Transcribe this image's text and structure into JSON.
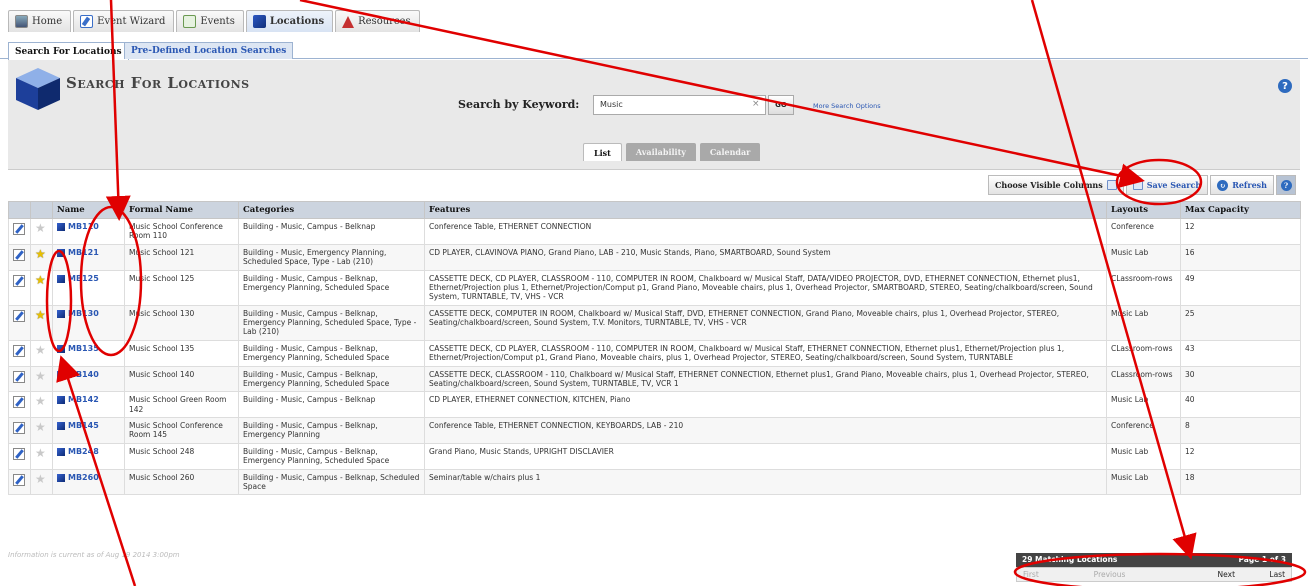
{
  "topnav": {
    "tabs": [
      {
        "label": "Home",
        "icon": "home-icon"
      },
      {
        "label": "Event Wizard",
        "icon": "wizard-icon"
      },
      {
        "label": "Events",
        "icon": "events-icon"
      },
      {
        "label": "Locations",
        "icon": "locations-icon"
      },
      {
        "label": "Resources",
        "icon": "resources-icon"
      }
    ],
    "active": "Locations"
  },
  "subnav": {
    "tabs": [
      "Search For Locations",
      "Pre-Defined Location Searches"
    ]
  },
  "panel": {
    "title": "Search For Locations",
    "help": "?",
    "keyword_label": "Search by Keyword:",
    "keyword_value": "Music",
    "clear": "×",
    "go": "GO",
    "more": "More Search Options",
    "views": [
      "List",
      "Availability",
      "Calendar"
    ]
  },
  "toolbar": {
    "choose": "Choose Visible Columns",
    "save": "Save Search",
    "refresh": "Refresh",
    "help": "?"
  },
  "table": {
    "headers": [
      "",
      "",
      "Name",
      "Formal Name",
      "Categories",
      "Features",
      "Layouts",
      "Max Capacity"
    ],
    "rows": [
      {
        "fav": false,
        "name": "MB110",
        "formal": "Music School Conference Room 110",
        "cat": "Building - Music, Campus - Belknap",
        "feat": "Conference Table, ETHERNET CONNECTION",
        "layout": "Conference",
        "cap": "12"
      },
      {
        "fav": true,
        "name": "MB121",
        "formal": "Music School 121",
        "cat": "Building - Music, Emergency Planning, Scheduled Space, Type - Lab (210)",
        "feat": "CD PLAYER, CLAVINOVA PIANO, Grand Piano, LAB - 210, Music Stands, Piano, SMARTBOARD, Sound System",
        "layout": "Music Lab",
        "cap": "16"
      },
      {
        "fav": true,
        "name": "MB125",
        "formal": "Music School 125",
        "cat": "Building - Music, Campus - Belknap, Emergency Planning, Scheduled Space",
        "feat": "CASSETTE DECK, CD PLAYER, CLASSROOM - 110, COMPUTER IN ROOM, Chalkboard w/ Musical Staff, DATA/VIDEO PROJECTOR, DVD, ETHERNET CONNECTION, Ethernet plus1, Ethernet/Projection plus 1, Ethernet/Projection/Comput p1, Grand Piano, Moveable chairs, plus 1, Overhead Projector, SMARTBOARD, STEREO, Seating/chalkboard/screen, Sound System, TURNTABLE, TV, VHS - VCR",
        "layout": "CLassroom-rows",
        "cap": "49"
      },
      {
        "fav": true,
        "name": "MB130",
        "formal": "Music School 130",
        "cat": "Building - Music, Campus - Belknap, Emergency Planning, Scheduled Space, Type - Lab (210)",
        "feat": "CASSETTE DECK, COMPUTER IN ROOM, Chalkboard w/ Musical Staff, DVD, ETHERNET CONNECTION, Grand Piano, Moveable chairs, plus 1, Overhead Projector, STEREO, Seating/chalkboard/screen, Sound System, T.V. Monitors, TURNTABLE, TV, VHS - VCR",
        "layout": "Music Lab",
        "cap": "25"
      },
      {
        "fav": false,
        "name": "MB135",
        "formal": "Music School 135",
        "cat": "Building - Music, Campus - Belknap, Emergency Planning, Scheduled Space",
        "feat": "CASSETTE DECK, CD PLAYER, CLASSROOM - 110, COMPUTER IN ROOM, Chalkboard w/ Musical Staff, ETHERNET CONNECTION, Ethernet plus1, Ethernet/Projection plus 1, Ethernet/Projection/Comput p1, Grand Piano, Moveable chairs, plus 1, Overhead Projector, STEREO, Seating/chalkboard/screen, Sound System, TURNTABLE",
        "layout": "CLassroom-rows",
        "cap": "43"
      },
      {
        "fav": false,
        "name": "MB140",
        "formal": "Music School 140",
        "cat": "Building - Music, Campus - Belknap, Emergency Planning, Scheduled Space",
        "feat": "CASSETTE DECK, CLASSROOM - 110, Chalkboard w/ Musical Staff, ETHERNET CONNECTION, Ethernet plus1, Grand Piano, Moveable chairs, plus 1, Overhead Projector, STEREO, Seating/chalkboard/screen, Sound System, TURNTABLE, TV, VCR 1",
        "layout": "CLassroom-rows",
        "cap": "30"
      },
      {
        "fav": false,
        "name": "MB142",
        "formal": "Music School Green Room 142",
        "cat": "Building - Music, Campus - Belknap",
        "feat": "CD PLAYER, ETHERNET CONNECTION, KITCHEN, Piano",
        "layout": "Music Lab",
        "cap": "40"
      },
      {
        "fav": false,
        "name": "MB145",
        "formal": "Music School Conference Room 145",
        "cat": "Building - Music, Campus - Belknap, Emergency Planning",
        "feat": "Conference Table, ETHERNET CONNECTION, KEYBOARDS, LAB - 210",
        "layout": "Conference",
        "cap": "8"
      },
      {
        "fav": false,
        "name": "MB248",
        "formal": "Music School 248",
        "cat": "Building - Music, Campus - Belknap, Emergency Planning, Scheduled Space",
        "feat": "Grand Piano, Music Stands, UPRIGHT DISCLAVIER",
        "layout": "Music Lab",
        "cap": "12"
      },
      {
        "fav": false,
        "name": "MB260",
        "formal": "Music School 260",
        "cat": "Building - Music, Campus - Belknap, Scheduled Space",
        "feat": "Seminar/table w/chairs plus 1",
        "layout": "Music Lab",
        "cap": "18"
      }
    ]
  },
  "footer": {
    "info": "Information is current as of Aug 19 2014 3:00pm",
    "matching": "29 Matching Locations",
    "page": "Page 1 of 3",
    "first": "First",
    "previous": "Previous",
    "next": "Next",
    "last": "Last"
  },
  "colors": {
    "annotation": "#e00000",
    "link": "#2a57b3",
    "header_bg": "#ccd4df",
    "star_on": "#e8c000"
  }
}
